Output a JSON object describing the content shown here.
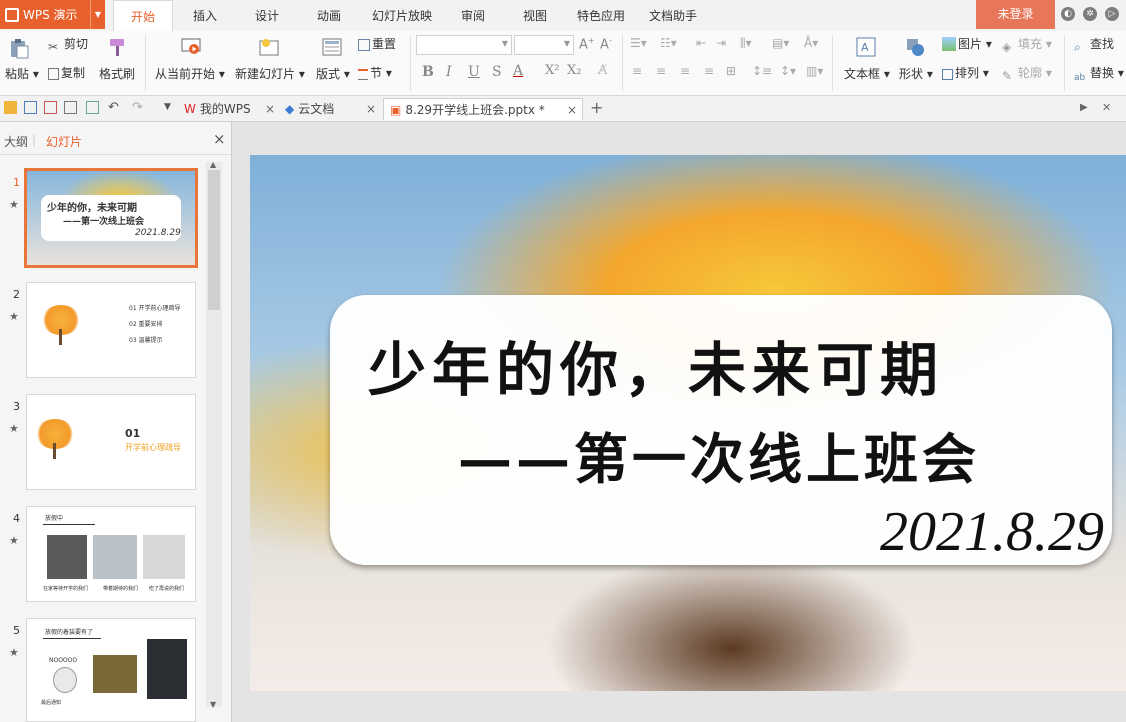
{
  "app": {
    "name": "WPS 演示",
    "login": "未登录"
  },
  "ribbon_tabs": [
    "开始",
    "插入",
    "设计",
    "动画",
    "幻灯片放映",
    "审阅",
    "视图",
    "特色应用",
    "文档助手"
  ],
  "ribbon": {
    "paste": "粘贴",
    "cut": "剪切",
    "copy": "复制",
    "format_painter": "格式刷",
    "from_current": "从当前开始",
    "new_slide": "新建幻灯片",
    "layout": "版式",
    "reset": "重置",
    "section": "节",
    "textbox": "文本框",
    "shape": "形状",
    "picture": "图片",
    "fill": "填充",
    "arrange": "排列",
    "outline": "轮廓",
    "find": "查找",
    "replace": "替换"
  },
  "doc_tabs": [
    {
      "label": "我的WPS"
    },
    {
      "label": "云文档"
    },
    {
      "label": "8.29开学线上班会.pptx *"
    }
  ],
  "left_panel": {
    "outline_tab": "大纲",
    "slides_tab": "幻灯片"
  },
  "thumbnails": [
    {
      "num": "1",
      "title": "少年的你，未来可期",
      "subtitle": "——第一次线上班会",
      "date": "2021.8.29"
    },
    {
      "num": "2",
      "items": [
        "01  开学前心理疏导",
        "02  重要安排",
        "03  温馨提示"
      ]
    },
    {
      "num": "3",
      "index": "01",
      "heading": "开学前心理疏导"
    },
    {
      "num": "4",
      "heading": "放假中",
      "captions": [
        "在家等待开学的我们",
        "带着期待的我们",
        "吃了再说的我们"
      ]
    },
    {
      "num": "5",
      "heading": "放假的着装要有了",
      "caption": "NOOOOO",
      "footer": "最后通知"
    }
  ],
  "slide": {
    "title": "少年的你，未来可期",
    "subtitle": "——第一次线上班会",
    "date": "2021.8.29"
  }
}
